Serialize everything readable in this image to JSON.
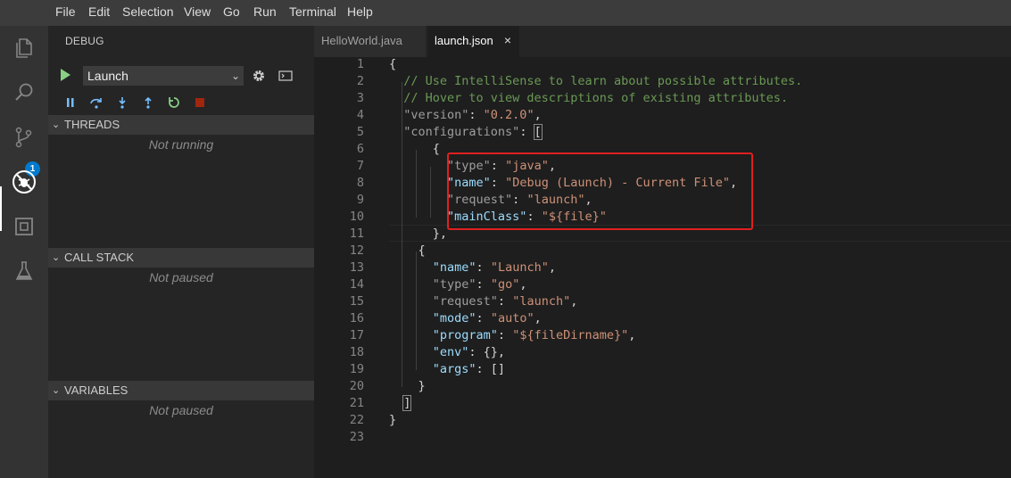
{
  "menu": [
    "File",
    "Edit",
    "Selection",
    "View",
    "Go",
    "Run",
    "Terminal",
    "Help"
  ],
  "activity": {
    "icons": [
      "files-icon",
      "search-icon",
      "source-control-icon",
      "debug-icon",
      "extensions-icon",
      "test-icon"
    ],
    "scm_badge": "1"
  },
  "sidebar": {
    "title": "DEBUG",
    "launch_config": "Launch",
    "sections": [
      {
        "title": "THREADS",
        "status": "Not running"
      },
      {
        "title": "CALL STACK",
        "status": "Not paused"
      },
      {
        "title": "VARIABLES",
        "status": "Not paused"
      }
    ]
  },
  "tabs": [
    {
      "label": "HelloWorld.java",
      "active": false
    },
    {
      "label": "launch.json",
      "active": true,
      "close": "×"
    }
  ],
  "editor": {
    "line_numbers": [
      "1",
      "2",
      "3",
      "4",
      "5",
      "6",
      "7",
      "8",
      "9",
      "10",
      "11",
      "12",
      "13",
      "14",
      "15",
      "16",
      "17",
      "18",
      "19",
      "20",
      "21",
      "22",
      "23"
    ],
    "lines": [
      [
        {
          "t": "p",
          "v": "{"
        }
      ],
      [
        {
          "t": "c",
          "v": "  // Use IntelliSense to learn about possible attributes."
        }
      ],
      [
        {
          "t": "c",
          "v": "  // Hover to view descriptions of existing attributes."
        }
      ],
      [
        {
          "t": "kg",
          "v": "  \"version\""
        },
        {
          "t": "p",
          "v": ": "
        },
        {
          "t": "s",
          "v": "\"0.2.0\""
        },
        {
          "t": "p",
          "v": ","
        }
      ],
      [
        {
          "t": "kg",
          "v": "  \"configurations\""
        },
        {
          "t": "p",
          "v": ": "
        },
        {
          "t": "pb",
          "v": "["
        }
      ],
      [
        {
          "t": "p",
          "v": "      {"
        }
      ],
      [
        {
          "t": "kg",
          "v": "        \"type\""
        },
        {
          "t": "p",
          "v": ": "
        },
        {
          "t": "s",
          "v": "\"java\""
        },
        {
          "t": "p",
          "v": ","
        }
      ],
      [
        {
          "t": "k",
          "v": "        \"name\""
        },
        {
          "t": "p",
          "v": ": "
        },
        {
          "t": "s",
          "v": "\"Debug (Launch) - Current File\""
        },
        {
          "t": "p",
          "v": ","
        }
      ],
      [
        {
          "t": "kg",
          "v": "        \"request\""
        },
        {
          "t": "p",
          "v": ": "
        },
        {
          "t": "s",
          "v": "\"launch\""
        },
        {
          "t": "p",
          "v": ","
        }
      ],
      [
        {
          "t": "k",
          "v": "        \"mainClass\""
        },
        {
          "t": "p",
          "v": ": "
        },
        {
          "t": "s",
          "v": "\"${file}\""
        }
      ],
      [
        {
          "t": "p",
          "v": "      },"
        }
      ],
      [
        {
          "t": "p",
          "v": "    {"
        }
      ],
      [
        {
          "t": "k",
          "v": "      \"name\""
        },
        {
          "t": "p",
          "v": ": "
        },
        {
          "t": "s",
          "v": "\"Launch\""
        },
        {
          "t": "p",
          "v": ","
        }
      ],
      [
        {
          "t": "kg",
          "v": "      \"type\""
        },
        {
          "t": "p",
          "v": ": "
        },
        {
          "t": "s",
          "v": "\"go\""
        },
        {
          "t": "p",
          "v": ","
        }
      ],
      [
        {
          "t": "kg",
          "v": "      \"request\""
        },
        {
          "t": "p",
          "v": ": "
        },
        {
          "t": "s",
          "v": "\"launch\""
        },
        {
          "t": "p",
          "v": ","
        }
      ],
      [
        {
          "t": "k",
          "v": "      \"mode\""
        },
        {
          "t": "p",
          "v": ": "
        },
        {
          "t": "s",
          "v": "\"auto\""
        },
        {
          "t": "p",
          "v": ","
        }
      ],
      [
        {
          "t": "k",
          "v": "      \"program\""
        },
        {
          "t": "p",
          "v": ": "
        },
        {
          "t": "s",
          "v": "\"${fileDirname}\""
        },
        {
          "t": "p",
          "v": ","
        }
      ],
      [
        {
          "t": "k",
          "v": "      \"env\""
        },
        {
          "t": "p",
          "v": ": {},"
        }
      ],
      [
        {
          "t": "k",
          "v": "      \"args\""
        },
        {
          "t": "p",
          "v": ": []"
        }
      ],
      [
        {
          "t": "p",
          "v": "    }"
        }
      ],
      [
        {
          "t": "pb",
          "v": "  ]"
        }
      ],
      [
        {
          "t": "p",
          "v": "}"
        }
      ],
      []
    ]
  },
  "colors": {
    "accent": "#007acc",
    "highlight_box": "#e02020",
    "play": "#89d185"
  }
}
